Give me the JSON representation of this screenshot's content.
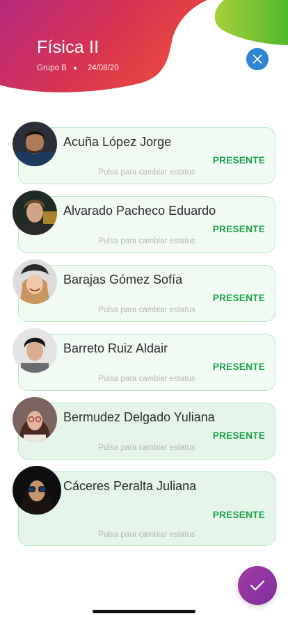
{
  "header": {
    "title": "Física II",
    "group": "Grupo B",
    "date": "24/08/20",
    "gradient_start": "#c2297a",
    "gradient_end": "#e8424b",
    "accent_green": "#7cc42a"
  },
  "close_button": {
    "icon": "close-icon",
    "color": "#2e86d1"
  },
  "students": [
    {
      "name": "Acuña López Jorge",
      "status": "PRESENTE",
      "hint": "Pulsa para cambiar estatus"
    },
    {
      "name": "Alvarado Pacheco Eduardo",
      "status": "PRESENTE",
      "hint": "Pulsa para cambiar estatus"
    },
    {
      "name": "Barajas Gómez Sofía",
      "status": "PRESENTE",
      "hint": "Pulsa para cambiar estatus"
    },
    {
      "name": "Barreto Ruiz Aldair",
      "status": "PRESENTE",
      "hint": "Pulsa para cambiar estatus"
    },
    {
      "name": "Bermudez Delgado Yuliana",
      "status": "PRESENTE",
      "hint": "Pulsa para cambiar estatus"
    },
    {
      "name": "Cáceres Peralta Juliana",
      "status": "PRESENTE",
      "hint": "Pulsa para cambiar estatus"
    }
  ],
  "confirm_button": {
    "icon": "check-icon"
  },
  "status_color": "#1ea24a"
}
